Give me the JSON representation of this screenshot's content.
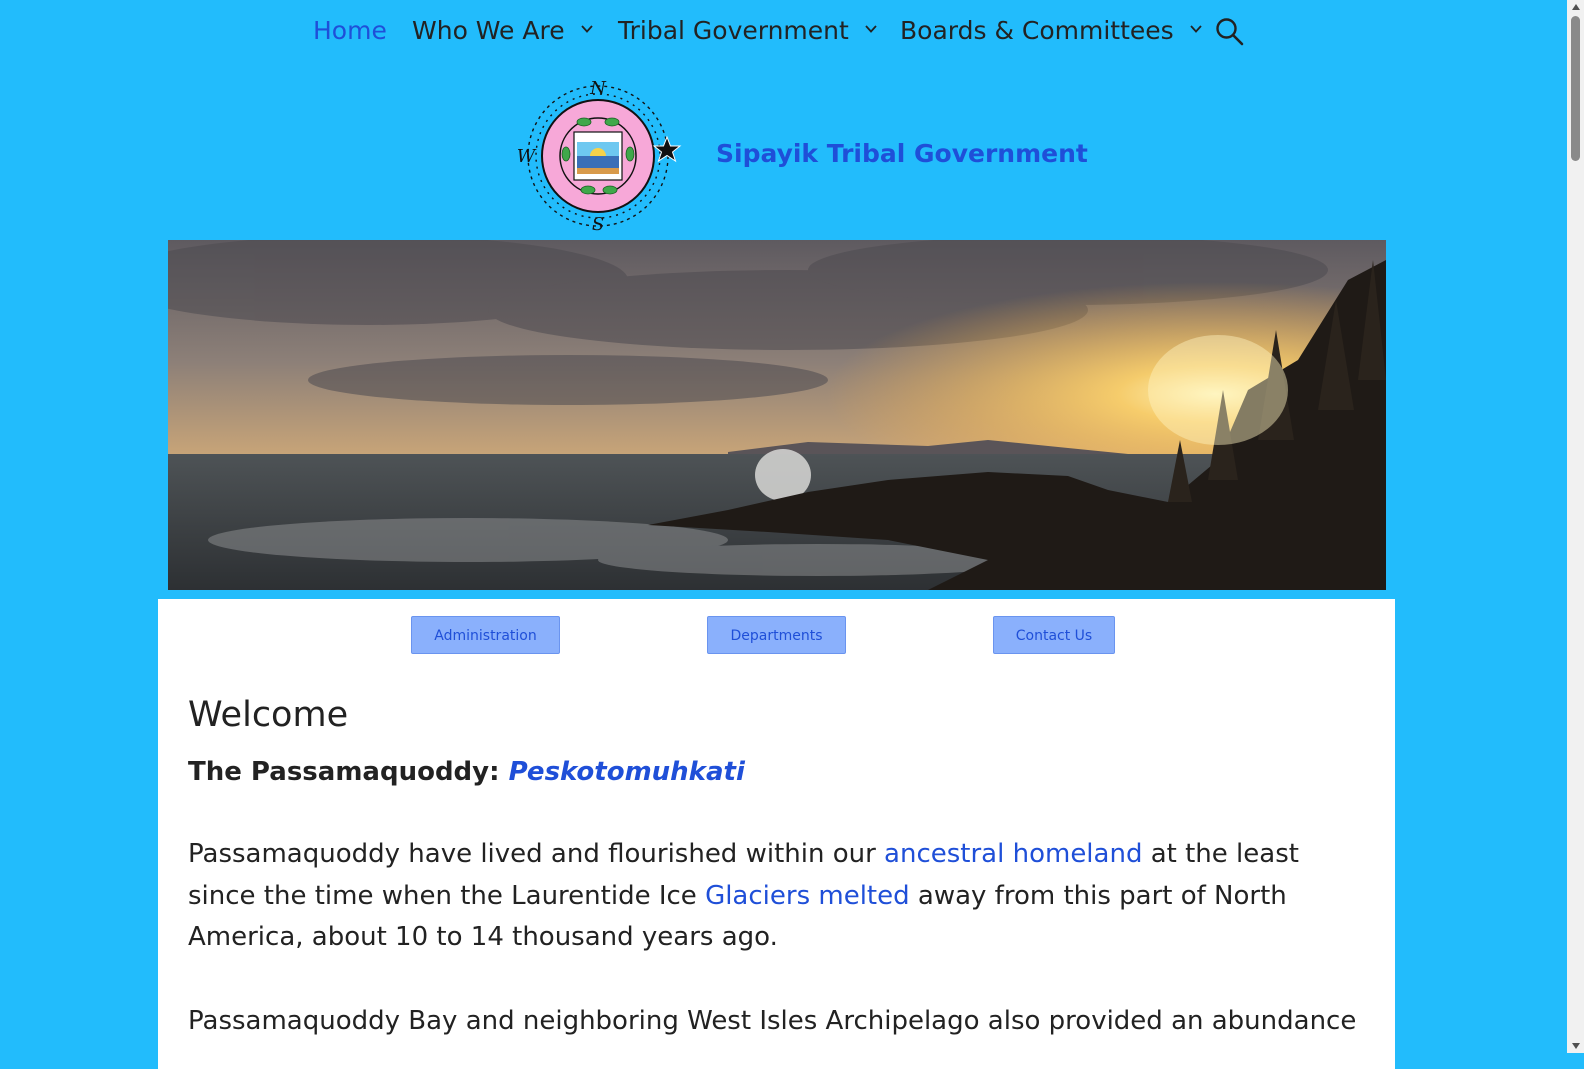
{
  "nav": {
    "items": [
      {
        "label": "Home"
      },
      {
        "label": "Who We Are"
      },
      {
        "label": "Tribal Government"
      },
      {
        "label": "Boards & Committees"
      }
    ]
  },
  "brand": {
    "site_title": "Sipayik Tribal Government",
    "logo_compass": {
      "n": "N",
      "s": "S",
      "w": "W"
    }
  },
  "buttons": {
    "administration": "Administration",
    "departments": "Departments",
    "contact": "Contact Us"
  },
  "content": {
    "heading": "Welcome",
    "sub_prefix": "The Passamaquoddy: ",
    "sub_link": "Peskotomuhkati",
    "p1_a": "Passamaquoddy have lived and flourished within our ",
    "p1_link1": "ancestral homeland",
    "p1_b": " at the least since the time when the Laurentide Ice ",
    "p1_link2": "Glaciers melted",
    "p1_c": " away from this part of North America, about 10 to 14 thousand years ago.",
    "p2": "Passamaquoddy Bay and neighboring West Isles Archipelago also provided an abundance"
  },
  "colors": {
    "background": "#22bcfc",
    "link": "#1f4fd8",
    "button": "#8ab0fc"
  }
}
